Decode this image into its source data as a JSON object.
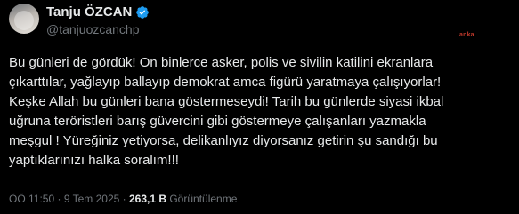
{
  "author": {
    "display_name": "Tanju ÖZCAN",
    "handle": "@tanjuozcanchp",
    "verified_icon": "verified-badge-icon"
  },
  "watermark": "anka",
  "tweet": {
    "text": "Bu günleri de gördük! On binlerce asker, polis ve sivilin katilini ekranlara\nçıkarttılar, yağlayıp ballayıp demokrat amca figürü yaratmaya çalışıyorlar!\nKeşke Allah bu günleri bana göstermeseydi! Tarih bu günlerde siyasi ikbal\nuğruna teröristleri barış güvercini gibi göstermeye çalışanları yazmakla\nmeşgul ! Yüreğiniz yetiyorsa, delikanlıyız diyorsanız getirin şu sandığı bu\nyaptıklarınızı halka soralım!!!"
  },
  "meta": {
    "time": "ÖÖ 11:50",
    "separator": " · ",
    "date": "9 Tem 2025",
    "views": "263,1 B",
    "views_label": " Görüntülenme"
  },
  "colors": {
    "background": "#000000",
    "text": "#e7e9ea",
    "secondary": "#71767b",
    "verified": "#1d9bf0"
  }
}
